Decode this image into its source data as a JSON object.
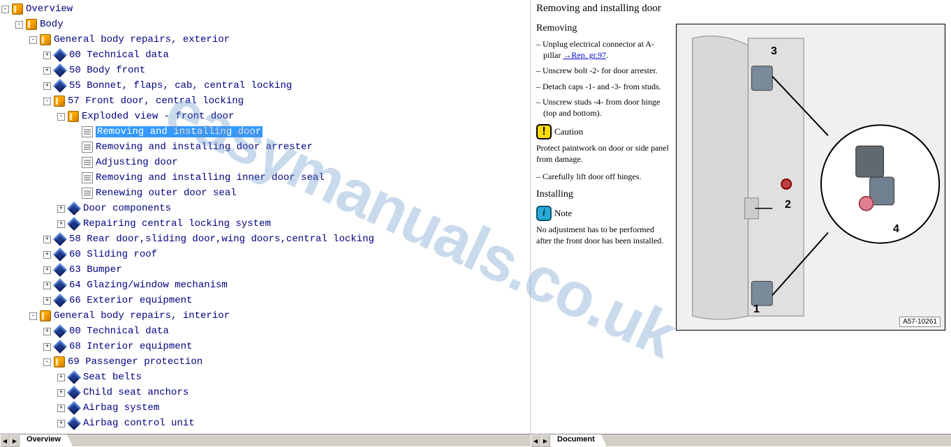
{
  "watermark": "easymanuals.co.uk",
  "tree": [
    {
      "depth": 0,
      "exp": "-",
      "icon": "book",
      "label": "Overview"
    },
    {
      "depth": 1,
      "exp": "-",
      "icon": "book",
      "label": "Body"
    },
    {
      "depth": 2,
      "exp": "-",
      "icon": "book",
      "label": "General body repairs, exterior"
    },
    {
      "depth": 3,
      "exp": "+",
      "icon": "diamond",
      "label": "00 Technical data"
    },
    {
      "depth": 3,
      "exp": "+",
      "icon": "diamond",
      "label": "50 Body front"
    },
    {
      "depth": 3,
      "exp": "+",
      "icon": "diamond",
      "label": "55 Bonnet, flaps, cab, central locking"
    },
    {
      "depth": 3,
      "exp": "-",
      "icon": "book",
      "label": "57 Front door, central locking"
    },
    {
      "depth": 4,
      "exp": "-",
      "icon": "book",
      "label": "Exploded view - front door"
    },
    {
      "depth": 5,
      "exp": " ",
      "icon": "doc",
      "label": "Removing and installing door",
      "selected": true
    },
    {
      "depth": 5,
      "exp": " ",
      "icon": "doc",
      "label": "Removing and installing door arrester"
    },
    {
      "depth": 5,
      "exp": " ",
      "icon": "doc",
      "label": "Adjusting door"
    },
    {
      "depth": 5,
      "exp": " ",
      "icon": "doc",
      "label": "Removing and installing inner door seal"
    },
    {
      "depth": 5,
      "exp": " ",
      "icon": "doc",
      "label": "Renewing outer door seal"
    },
    {
      "depth": 4,
      "exp": "+",
      "icon": "diamond",
      "label": "Door components"
    },
    {
      "depth": 4,
      "exp": "+",
      "icon": "diamond",
      "label": "Repairing central locking system"
    },
    {
      "depth": 3,
      "exp": "+",
      "icon": "diamond",
      "label": "58 Rear door,sliding door,wing doors,central locking"
    },
    {
      "depth": 3,
      "exp": "+",
      "icon": "diamond",
      "label": "60 Sliding roof"
    },
    {
      "depth": 3,
      "exp": "+",
      "icon": "diamond",
      "label": "63 Bumper"
    },
    {
      "depth": 3,
      "exp": "+",
      "icon": "diamond",
      "label": "64 Glazing/window mechanism"
    },
    {
      "depth": 3,
      "exp": "+",
      "icon": "diamond",
      "label": "66 Exterior equipment"
    },
    {
      "depth": 2,
      "exp": "-",
      "icon": "book",
      "label": "General body repairs, interior"
    },
    {
      "depth": 3,
      "exp": "+",
      "icon": "diamond",
      "label": "00 Technical data"
    },
    {
      "depth": 3,
      "exp": "+",
      "icon": "diamond",
      "label": "68 Interior equipment"
    },
    {
      "depth": 3,
      "exp": "-",
      "icon": "book",
      "label": "69 Passenger protection"
    },
    {
      "depth": 4,
      "exp": "+",
      "icon": "diamond",
      "label": "Seat belts"
    },
    {
      "depth": 4,
      "exp": "+",
      "icon": "diamond",
      "label": "Child seat anchors"
    },
    {
      "depth": 4,
      "exp": "+",
      "icon": "diamond",
      "label": "Airbag system"
    },
    {
      "depth": 4,
      "exp": "+",
      "icon": "diamond",
      "label": "Airbag control unit"
    }
  ],
  "tabs": {
    "left": "Overview",
    "right": "Document"
  },
  "doc": {
    "title": "Removing and installing door",
    "section1": "Removing",
    "step1a": "Unplug electrical connector at A-pillar",
    "link1": "→Rep. gr.97",
    "step2": "Unscrew bolt -2- for door arrester.",
    "step3": "Detach caps -1- and -3- from studs.",
    "step4": "Unscrew studs -4- from door hinge (top and bottom).",
    "caution_label": "Caution",
    "caution_text": "Protect paintwork on door or side panel from damage.",
    "step5": "Carefully lift door off hinges.",
    "section2": "Installing",
    "note_label": "Note",
    "note_text": "No adjustment has to be performed after the front door has been installed.",
    "diagram_code": "A57-10261",
    "d1": "1",
    "d2": "2",
    "d3": "3",
    "d4": "4"
  }
}
